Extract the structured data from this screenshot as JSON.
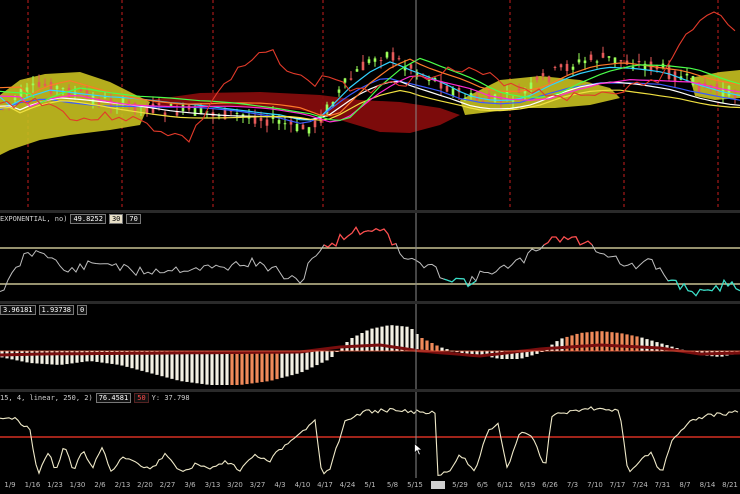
{
  "panels": {
    "rsi": {
      "label": "EXPONENTIAL, no)",
      "value": "49.8252",
      "lower": "30",
      "upper": "70"
    },
    "macd": {
      "value1": "3.96181",
      "value2": "1.93738",
      "value3": "0"
    },
    "stoch": {
      "label": "15, 4, linear, 250, 2)",
      "value": "76.4581",
      "level": "50",
      "y_readout": "Y: 37.798"
    }
  },
  "x_axis": {
    "labels": [
      "1/9",
      "1/16",
      "1/23",
      "1/30",
      "2/6",
      "2/13",
      "2/20",
      "2/27",
      "3/6",
      "3/13",
      "3/20",
      "3/27",
      "4/3",
      "4/10",
      "4/17",
      "4/24",
      "5/1",
      "5/8",
      "5/15",
      "",
      "5/29",
      "6/5",
      "6/12",
      "6/19",
      "6/26",
      "7/3",
      "7/10",
      "7/17",
      "7/24",
      "7/31",
      "8/7",
      "8/14",
      "8/21"
    ],
    "selected_index": 19
  },
  "colors": {
    "background": "#000000",
    "cloud_bull": "#c8c020",
    "cloud_bear": "#8a0c0c",
    "candle_up": "#9cff5a",
    "candle_down": "#e65a5a",
    "rsi_line": "#bdbdbd",
    "rsi_overbought": "#ff4a4a",
    "rsi_oversold": "#34e0c8",
    "hist_light": "#f4f1e4",
    "hist_orange": "#f08a5a",
    "hist_dark": "#7a0e0e",
    "stoch_line": "#efe9c8",
    "stoch_level": "#ff3a2a",
    "band_line": "#f0e8b0",
    "vertical_marker": "#c81e1e"
  },
  "icons": {
    "cursor": "mouse-pointer-icon"
  }
}
